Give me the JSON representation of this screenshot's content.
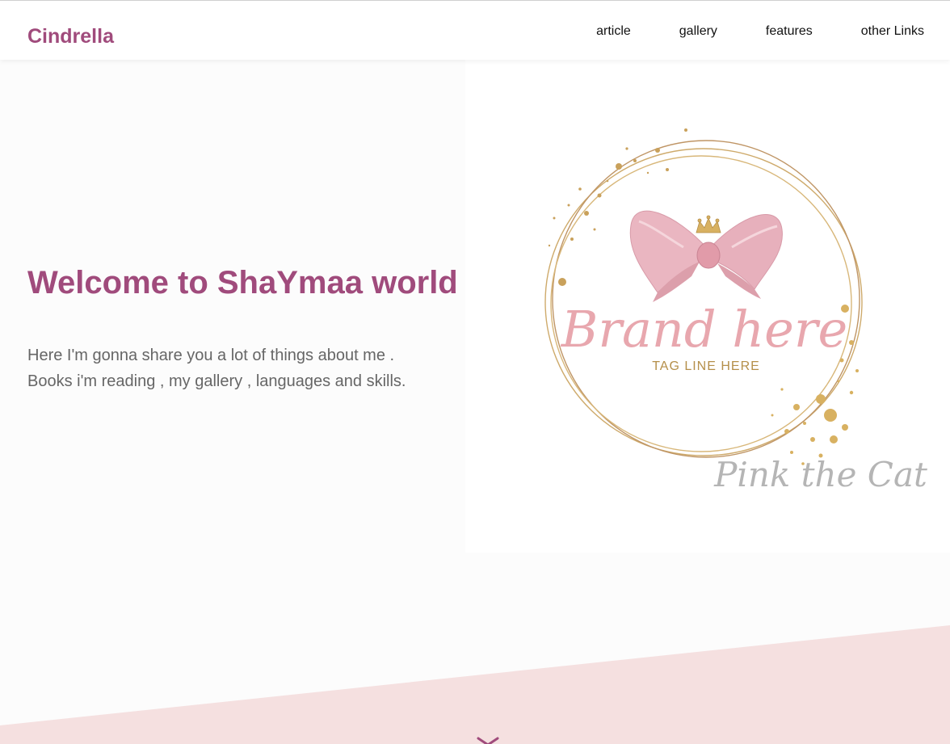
{
  "header": {
    "logo": "Cindrella",
    "nav": [
      {
        "label": "article"
      },
      {
        "label": "gallery"
      },
      {
        "label": "features"
      },
      {
        "label": "other Links"
      }
    ]
  },
  "hero": {
    "title": "Welcome to ShaYmaa world",
    "lines": [
      "Here I'm gonna share you a lot of things about me .",
      "Books i'm reading , my gallery , languages and skills."
    ],
    "image": {
      "brand_text": "Brand here",
      "tagline": "TAG LINE HERE",
      "signature": "Pink the Cat",
      "icons": [
        "bow-icon",
        "crown-icon"
      ]
    }
  },
  "colors": {
    "accent": "#a04b7c",
    "band": "#f5e0e0",
    "brand_pink": "#e8a7ae",
    "gold": "#c9a15b"
  }
}
